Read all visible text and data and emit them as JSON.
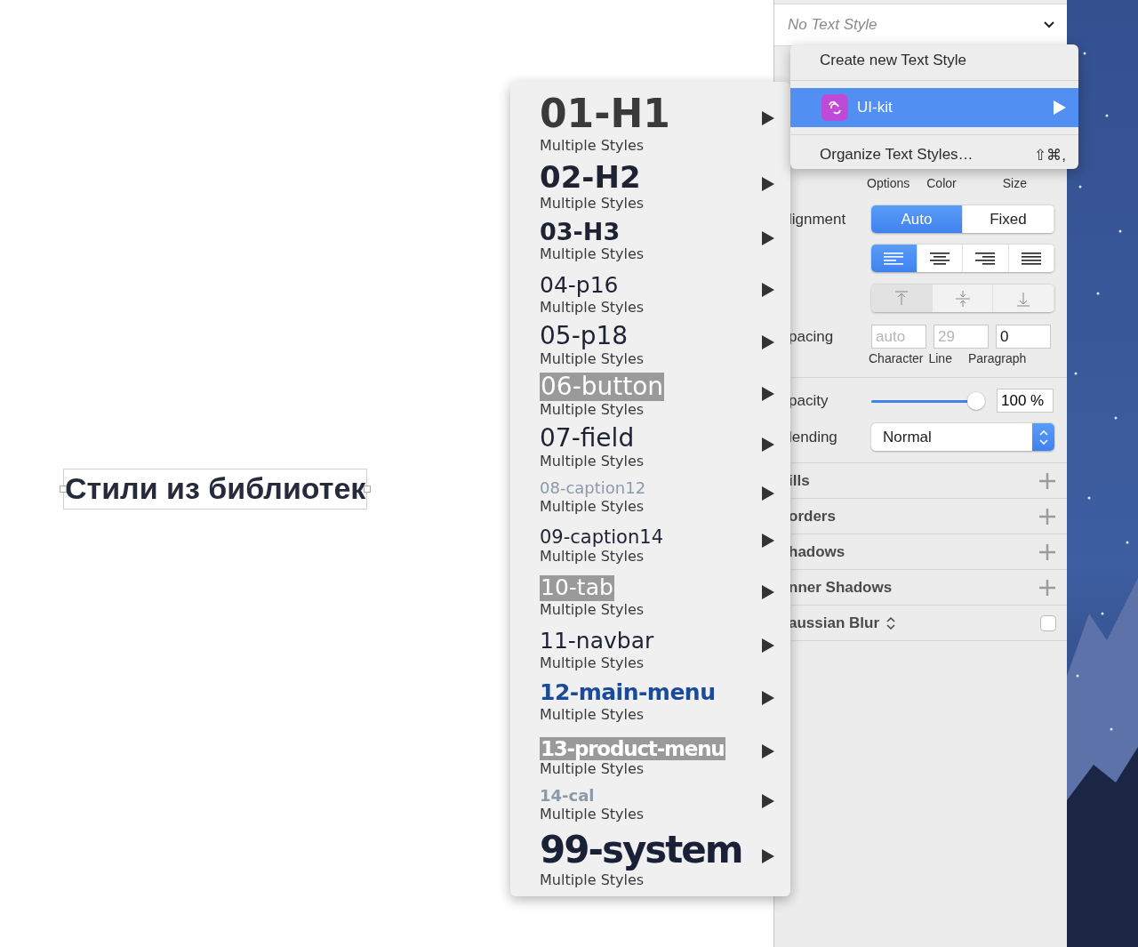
{
  "canvas": {
    "text_layer": "Стили из библиотек"
  },
  "inspector": {
    "text_style": {
      "value": "No Text Style"
    },
    "option_labels": [
      "Options",
      "Color",
      "Size"
    ],
    "alignment": {
      "label": "lignment",
      "options": [
        {
          "label": "Auto",
          "selected": true
        },
        {
          "label": "Fixed",
          "selected": false
        }
      ]
    },
    "text_align": [
      {
        "kind": "left",
        "selected": true
      },
      {
        "kind": "center",
        "selected": false
      },
      {
        "kind": "right",
        "selected": false
      },
      {
        "kind": "justify",
        "selected": false
      }
    ],
    "vertical_align": [
      {
        "kind": "top",
        "selected": true
      },
      {
        "kind": "middle",
        "selected": false
      },
      {
        "kind": "bottom",
        "selected": false
      }
    ],
    "spacing": {
      "label": "pacing",
      "fields": [
        {
          "placeholder": "auto",
          "caption": "Character"
        },
        {
          "placeholder": "29",
          "caption": "Line"
        },
        {
          "value": "0",
          "caption": "Paragraph"
        }
      ]
    },
    "opacity": {
      "label": "pacity",
      "level": 1,
      "value": "100 %"
    },
    "blending": {
      "label": "lending",
      "value": "Normal"
    },
    "sections": [
      {
        "title": "ills",
        "kind": "add"
      },
      {
        "title": "orders",
        "kind": "add"
      },
      {
        "title": "hadows",
        "kind": "add"
      },
      {
        "title": "nner Shadows",
        "kind": "add"
      },
      {
        "title": "aussian Blur",
        "kind": "toggle",
        "checked": false
      }
    ]
  },
  "text_style_menu": {
    "items": [
      {
        "kind": "action",
        "label": "Create new Text Style"
      },
      {
        "kind": "separator"
      },
      {
        "kind": "library",
        "label": "UI-kit",
        "selected": true
      },
      {
        "kind": "separator"
      },
      {
        "kind": "action",
        "label": "Organize Text Styles…",
        "shortcut": "⇧⌘,"
      }
    ]
  },
  "library_submenu": {
    "styles": [
      {
        "name": "01-H1",
        "kind": "h1",
        "detail": "Multiple Styles"
      },
      {
        "name": "02-H2",
        "kind": "h2",
        "detail": "Multiple Styles"
      },
      {
        "name": "03-H3",
        "kind": "h3",
        "detail": "Multiple Styles"
      },
      {
        "name": "04-p16",
        "kind": "p16",
        "detail": "Multiple Styles"
      },
      {
        "name": "05-p18",
        "kind": "p18",
        "detail": "Multiple Styles"
      },
      {
        "name": "06-button",
        "kind": "button",
        "detail": "Multiple Styles"
      },
      {
        "name": "07-field",
        "kind": "field",
        "detail": "Multiple Styles"
      },
      {
        "name": "08-caption12",
        "kind": "caption12",
        "detail": "Multiple Styles"
      },
      {
        "name": "09-caption14",
        "kind": "caption14",
        "detail": "Multiple Styles"
      },
      {
        "name": "10-tab",
        "kind": "tab",
        "detail": "Multiple Styles"
      },
      {
        "name": "11-navbar",
        "kind": "navbar",
        "detail": "Multiple Styles"
      },
      {
        "name": "12-main-menu",
        "kind": "mainmenu",
        "detail": "Multiple Styles"
      },
      {
        "name": "13-product-menu",
        "kind": "productmenu",
        "detail": "Multiple Styles"
      },
      {
        "name": "14-cal",
        "kind": "cal",
        "detail": "Multiple Styles"
      },
      {
        "name": "99-system",
        "kind": "system",
        "detail": "Multiple Styles"
      }
    ]
  }
}
